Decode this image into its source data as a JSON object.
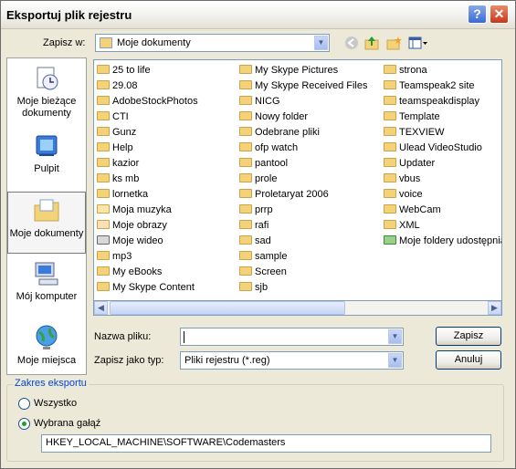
{
  "window": {
    "title": "Eksportuj plik rejestru",
    "help_glyph": "?",
    "close_glyph": "✕"
  },
  "save_in": {
    "label": "Zapisz w:",
    "value": "Moje dokumenty"
  },
  "places": [
    {
      "label": "Moje bieżące dokumenty",
      "icon": "recent-documents-icon"
    },
    {
      "label": "Pulpit",
      "icon": "desktop-icon"
    },
    {
      "label": "Moje dokumenty",
      "icon": "my-documents-icon"
    },
    {
      "label": "Mój komputer",
      "icon": "my-computer-icon"
    },
    {
      "label": "Moje miejsca",
      "icon": "network-places-icon"
    }
  ],
  "files": {
    "col1": [
      "25 to life",
      "29.08",
      "AdobeStockPhotos",
      "CTI",
      "Gunz",
      "Help",
      "kazior",
      "ks mb",
      "lornetka",
      "Moja muzyka",
      "Moje obrazy",
      "Moje wideo",
      "mp3",
      "My eBooks",
      "My Skype Content"
    ],
    "col2": [
      "My Skype Pictures",
      "My Skype Received Files",
      "NICG",
      "Nowy folder",
      "Odebrane pliki",
      "ofp watch",
      "pantool",
      "prole",
      "Proletaryat 2006",
      "prrp",
      "rafi",
      "sad",
      "sample",
      "Screen",
      "sjb"
    ],
    "col3": [
      "strona",
      "Teamspeak2 site",
      "teamspeakdisplay",
      "Template",
      "TEXVIEW",
      "Ulead VideoStudio",
      "Updater",
      "vbus",
      "voice",
      "WebCam",
      "XML",
      "Moje foldery udostępnia"
    ]
  },
  "filename": {
    "label": "Nazwa pliku:",
    "value": ""
  },
  "filetype": {
    "label": "Zapisz jako typ:",
    "value": "Pliki rejestru (*.reg)"
  },
  "buttons": {
    "save": "Zapisz",
    "cancel": "Anuluj"
  },
  "export_range": {
    "title": "Zakres eksportu",
    "all_label": "Wszystko",
    "branch_label": "Wybrana gałąź",
    "branch_value": "HKEY_LOCAL_MACHINE\\SOFTWARE\\Codemasters",
    "selected": "branch"
  }
}
